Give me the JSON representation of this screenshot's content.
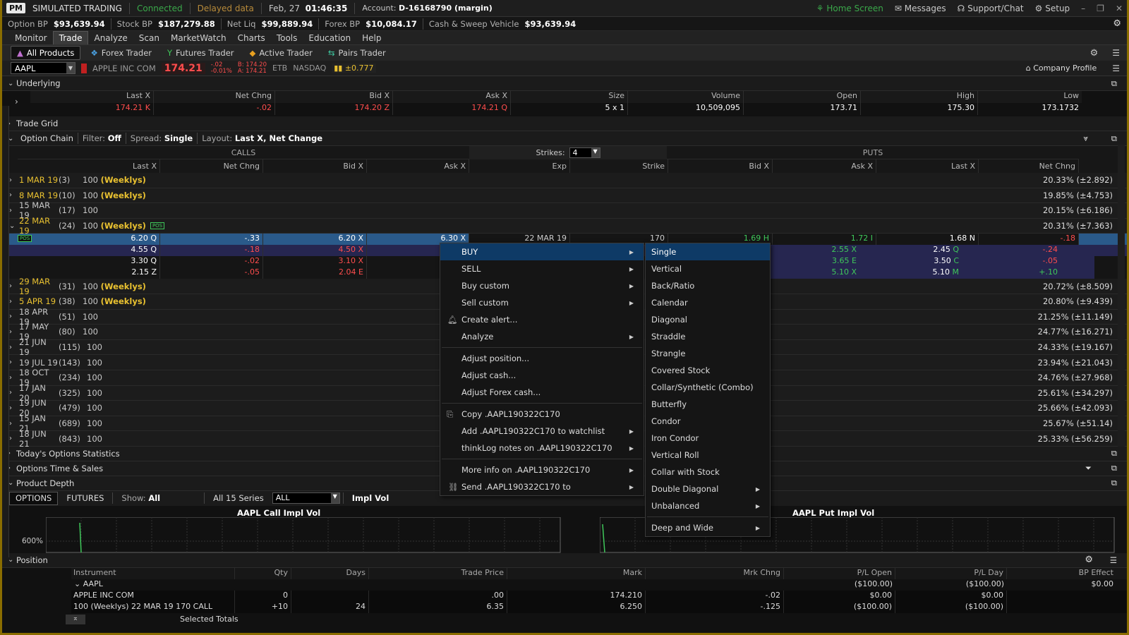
{
  "titlebar": {
    "logo": "PM",
    "mode": "SIMULATED TRADING",
    "status": "Connected",
    "data_mode": "Delayed data",
    "date": "Feb, 27",
    "time": "01:46:35",
    "account_label": "Account:",
    "account": "D-16168790 (margin)",
    "home": "Home Screen",
    "messages": "Messages",
    "support": "Support/Chat",
    "setup": "Setup"
  },
  "balances": [
    {
      "label": "Option BP",
      "value": "$93,639.94"
    },
    {
      "label": "Stock BP",
      "value": "$187,279.88"
    },
    {
      "label": "Net Liq",
      "value": "$99,889.94"
    },
    {
      "label": "Forex BP",
      "value": "$10,084.17"
    },
    {
      "label": "Cash & Sweep Vehicle",
      "value": "$93,639.94"
    }
  ],
  "menu": [
    "Monitor",
    "Trade",
    "Analyze",
    "Scan",
    "MarketWatch",
    "Charts",
    "Tools",
    "Education",
    "Help"
  ],
  "subtabs": [
    "All Products",
    "Forex Trader",
    "Futures Trader",
    "Active Trader",
    "Pairs Trader"
  ],
  "symbol": {
    "ticker": "AAPL",
    "name": "APPLE INC COM",
    "price": "174.21",
    "chg": "-.02",
    "chg_pct": "-0.01%",
    "bid": "B: 174.20",
    "ask": "A: 174.21",
    "etb": "ETB",
    "exchange": "NASDAQ",
    "move": "±0.777",
    "company_profile": "Company Profile"
  },
  "underlying": {
    "title": "Underlying",
    "headers": [
      "Last X",
      "Net Chng",
      "Bid X",
      "Ask X",
      "Size",
      "Volume",
      "Open",
      "High",
      "Low"
    ],
    "values": [
      {
        "v": "174.21",
        "x": "K"
      },
      {
        "v": "-.02",
        "x": ""
      },
      {
        "v": "174.20",
        "x": "Z"
      },
      {
        "v": "174.21",
        "x": "Q"
      },
      {
        "v": "5 x 1",
        "x": ""
      },
      {
        "v": "10,509,095",
        "x": ""
      },
      {
        "v": "173.71",
        "x": ""
      },
      {
        "v": "175.30",
        "x": ""
      },
      {
        "v": "173.1732",
        "x": ""
      }
    ]
  },
  "trade_grid": "Trade Grid",
  "option_chain": {
    "title": "Option Chain",
    "filter_label": "Filter:",
    "filter": "Off",
    "spread_label": "Spread:",
    "spread": "Single",
    "layout_label": "Layout:",
    "layout": "Last X, Net Change",
    "calls": "CALLS",
    "puts": "PUTS",
    "strikes_label": "Strikes:",
    "strikes": "4",
    "col_headers": [
      "Last X",
      "Net Chng",
      "Bid X",
      "Ask X",
      "Exp",
      "Strike",
      "Bid X",
      "Ask X",
      "Last X",
      "Net Chng"
    ],
    "expirations_top": [
      {
        "date": "1 MAR 19",
        "days": "(3)",
        "mult": "100",
        "weekly": "(Weeklys)",
        "iv": "20.33% (±2.892)"
      },
      {
        "date": "8 MAR 19",
        "days": "(10)",
        "mult": "100",
        "weekly": "(Weeklys)",
        "iv": "19.85% (±4.753)"
      },
      {
        "date": "15 MAR 19",
        "days": "(17)",
        "mult": "100",
        "weekly": "",
        "iv": "20.15% (±6.186)"
      },
      {
        "date": "22 MAR 19",
        "days": "(24)",
        "mult": "100",
        "weekly": "(Weeklys)",
        "iv": "20.31% (±7.363)",
        "pos": "POS"
      }
    ],
    "strike_rows": [
      {
        "c_last": "6.20",
        "c_lx": "Q",
        "c_chg": "-.33",
        "c_bid": "6.20",
        "c_bx": "X",
        "c_ask": "6.30",
        "c_ax": "X",
        "exp": "22 MAR 19",
        "strike": "170",
        "p_bid": "1.69",
        "p_bx": "H",
        "p_ask": "1.72",
        "p_ax": "I",
        "p_last": "1.68",
        "p_lx": "N",
        "p_chg": "-.18"
      },
      {
        "c_last": "4.55",
        "c_lx": "Q",
        "c_chg": "-.18",
        "c_bid": "4.50",
        "c_bx": "X",
        "p_ask": "2.55",
        "p_ax": "X",
        "p_last": "2.45",
        "p_lx": "Q",
        "p_chg": "-.24"
      },
      {
        "c_last": "3.30",
        "c_lx": "Q",
        "c_chg": "-.02",
        "c_bid": "3.10",
        "c_bx": "X",
        "p_ask": "3.65",
        "p_ax": "E",
        "p_last": "3.50",
        "p_lx": "C",
        "p_chg": "-.05"
      },
      {
        "c_last": "2.15",
        "c_lx": "Z",
        "c_chg": "-.05",
        "c_bid": "2.04",
        "c_bx": "E",
        "p_ask": "5.10",
        "p_ax": "X",
        "p_last": "5.10",
        "p_lx": "M",
        "p_chg": "+.10"
      }
    ],
    "expirations_bottom": [
      {
        "date": "29 MAR 19",
        "days": "(31)",
        "mult": "100",
        "weekly": "(Weeklys)",
        "iv": "20.72% (±8.509)"
      },
      {
        "date": "5 APR 19",
        "days": "(38)",
        "mult": "100",
        "weekly": "(Weeklys)",
        "iv": "20.80% (±9.439)"
      },
      {
        "date": "18 APR 19",
        "days": "(51)",
        "mult": "100",
        "weekly": "",
        "iv": "21.25% (±11.149)"
      },
      {
        "date": "17 MAY 19",
        "days": "(80)",
        "mult": "100",
        "weekly": "",
        "iv": "24.77% (±16.271)"
      },
      {
        "date": "21 JUN 19",
        "days": "(115)",
        "mult": "100",
        "weekly": "",
        "iv": "24.33% (±19.167)"
      },
      {
        "date": "19 JUL 19",
        "days": "(143)",
        "mult": "100",
        "weekly": "",
        "iv": "23.94% (±21.043)"
      },
      {
        "date": "18 OCT 19",
        "days": "(234)",
        "mult": "100",
        "weekly": "",
        "iv": "24.76% (±27.968)"
      },
      {
        "date": "17 JAN 20",
        "days": "(325)",
        "mult": "100",
        "weekly": "",
        "iv": "25.61% (±34.297)"
      },
      {
        "date": "19 JUN 20",
        "days": "(479)",
        "mult": "100",
        "weekly": "",
        "iv": "25.66% (±42.093)"
      },
      {
        "date": "15 JAN 21",
        "days": "(689)",
        "mult": "100",
        "weekly": "",
        "iv": "25.67% (±51.14)"
      },
      {
        "date": "18 JUN 21",
        "days": "(843)",
        "mult": "100",
        "weekly": "",
        "iv": "25.33% (±56.259)"
      }
    ]
  },
  "sections": {
    "stats": "Today's Options Statistics",
    "time_sales": "Options Time & Sales",
    "product_depth": "Product Depth",
    "position": "Position"
  },
  "depth": {
    "tabs": [
      "OPTIONS",
      "FUTURES"
    ],
    "show_label": "Show:",
    "show": "All",
    "series": "All 15 Series",
    "filter": "ALL",
    "metric": "Impl Vol",
    "call_title": "AAPL Call Impl Vol",
    "put_title": "AAPL Put Impl Vol",
    "y_label": "600%"
  },
  "position": {
    "headers": [
      "Instrument",
      "Qty",
      "Days",
      "Trade Price",
      "Mark",
      "Mrk Chng",
      "P/L Open",
      "P/L Day",
      "BP Effect"
    ],
    "group": "AAPL",
    "group_vals": {
      "pl_open": "($100.00)",
      "pl_day": "($100.00)",
      "bp": "$0.00"
    },
    "rows": [
      {
        "instr": "APPLE INC COM",
        "qty": "0",
        "days": "",
        "price": ".00",
        "mark": "174.210",
        "chg": "-.02",
        "pl_open": "$0.00",
        "pl_day": "$0.00",
        "bp": ""
      },
      {
        "instr": "100 (Weeklys) 22 MAR 19 170 CALL",
        "qty": "+10",
        "days": "24",
        "price": "6.35",
        "mark": "6.250",
        "chg": "-.125",
        "pl_open": "($100.00)",
        "pl_day": "($100.00)",
        "bp": ""
      }
    ],
    "totals": "Selected Totals"
  },
  "context_menu": {
    "items": [
      {
        "label": "BUY",
        "sub": true,
        "hl": true
      },
      {
        "label": "SELL",
        "sub": true
      },
      {
        "label": "Buy custom",
        "sub": true
      },
      {
        "label": "Sell custom",
        "sub": true
      },
      {
        "label": "Create alert...",
        "icon": "bell-icon"
      },
      {
        "label": "Analyze",
        "sub": true
      },
      {
        "sep": true
      },
      {
        "label": "Adjust position..."
      },
      {
        "label": "Adjust cash..."
      },
      {
        "label": "Adjust Forex cash..."
      },
      {
        "sep": true
      },
      {
        "label": "Copy .AAPL190322C170",
        "icon": "copy-icon"
      },
      {
        "label": "Add .AAPL190322C170 to watchlist",
        "sub": true
      },
      {
        "label": "thinkLog notes on .AAPL190322C170",
        "sub": true
      },
      {
        "sep": true
      },
      {
        "label": "More info on .AAPL190322C170",
        "sub": true
      },
      {
        "label": "Send .AAPL190322C170 to",
        "sub": true,
        "icon": "send-icon"
      }
    ],
    "buy_submenu": [
      {
        "label": "Single",
        "hl": true
      },
      {
        "label": "Vertical"
      },
      {
        "label": "Back/Ratio"
      },
      {
        "label": "Calendar"
      },
      {
        "label": "Diagonal"
      },
      {
        "label": "Straddle"
      },
      {
        "label": "Strangle"
      },
      {
        "label": "Covered Stock"
      },
      {
        "label": "Collar/Synthetic (Combo)"
      },
      {
        "label": "Butterfly"
      },
      {
        "label": "Condor"
      },
      {
        "label": "Iron Condor"
      },
      {
        "label": "Vertical Roll"
      },
      {
        "label": "Collar with Stock"
      },
      {
        "label": "Double Diagonal",
        "sub": true
      },
      {
        "label": "Unbalanced",
        "sub": true
      },
      {
        "sep": true
      },
      {
        "label": "Deep and Wide",
        "sub": true
      }
    ]
  }
}
